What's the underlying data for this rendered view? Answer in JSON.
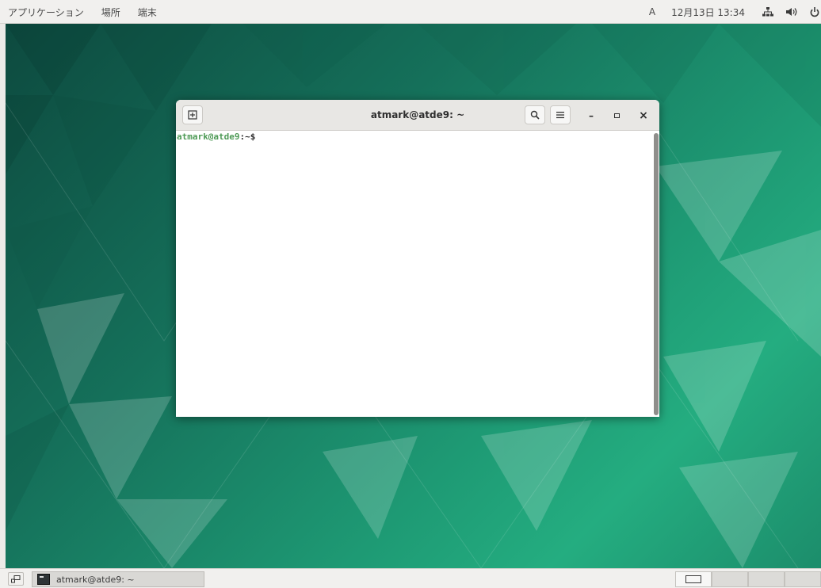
{
  "top_panel": {
    "menus": [
      "アプリケーション",
      "場所",
      "端末"
    ],
    "input_indicator": "A",
    "clock": "12月13日 13:34",
    "network_icon": "network-icon",
    "volume_icon": "volume-icon",
    "power_icon": "power-icon"
  },
  "terminal": {
    "title": "atmark@atde9: ~",
    "new_tab_icon": "new-tab-icon",
    "search_icon": "search-icon",
    "menu_icon": "hamburger-menu-icon",
    "minimize_label": "–",
    "maximize_label": "▫",
    "close_label": "×",
    "prompt_user": "atmark@atde9",
    "prompt_path": ":~$"
  },
  "taskbar": {
    "window_item": "atmark@atde9: ~",
    "workspaces": 4
  },
  "colors": {
    "prompt_green": "#4e9a56",
    "panel_bg": "#f1f0ee",
    "desktop_teal": "#1e9a74"
  }
}
